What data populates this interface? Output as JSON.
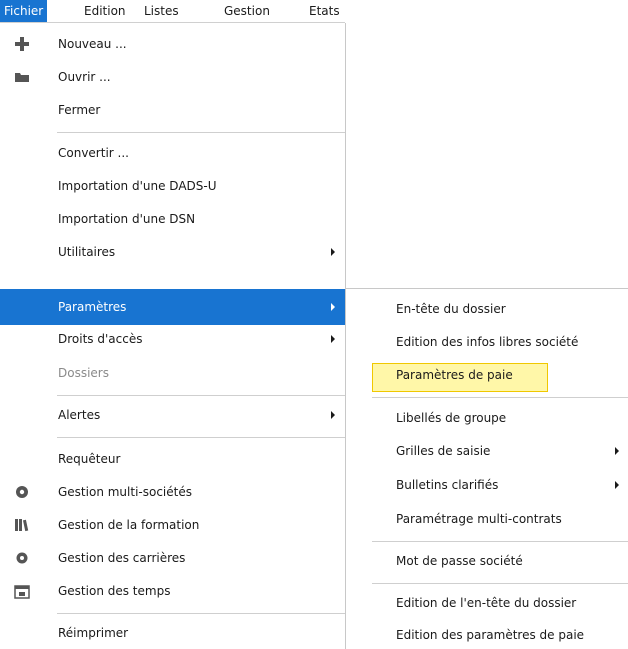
{
  "menubar": {
    "fichier": "Fichier",
    "edition": "Edition",
    "listes": "Listes",
    "gestion": "Gestion",
    "etats": "Etats"
  },
  "main_menu": {
    "nouveau": "Nouveau ...",
    "ouvrir": "Ouvrir ...",
    "fermer": "Fermer",
    "convertir": "Convertir ...",
    "import_dads": "Importation d'une DADS-U",
    "import_dsn": "Importation d'une DSN",
    "utilitaires": "Utilitaires",
    "parametres": "Paramètres",
    "droits": "Droits d'accès",
    "dossiers": "Dossiers",
    "alertes": "Alertes",
    "requeteur": "Requêteur",
    "multi_societes": "Gestion multi-sociétés",
    "formation": "Gestion de la formation",
    "carrieres": "Gestion des carrières",
    "temps": "Gestion des temps",
    "reimprimer": "Réimprimer"
  },
  "sub_menu": {
    "entete": "En-tête du dossier",
    "infos_libres": "Edition des infos libres société",
    "parametres_paie": "Paramètres de paie",
    "libelles_groupe": "Libellés de groupe",
    "grilles_saisie": "Grilles de saisie",
    "bulletins": "Bulletins clarifiés",
    "multi_contrats": "Paramétrage multi-contrats",
    "mot_de_passe": "Mot de passe société",
    "edition_entete": "Edition de l'en-tête du dossier",
    "edition_parametres": "Edition des paramètres de paie"
  },
  "colors": {
    "selection": "#1874d1",
    "highlight_fill": "#fff7a8",
    "highlight_border": "#f0c800"
  }
}
